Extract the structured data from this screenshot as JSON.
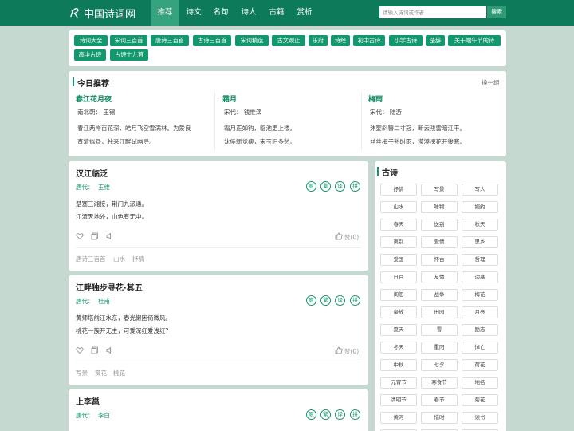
{
  "header": {
    "logo_text": "中国诗词网",
    "nav": [
      "推荐",
      "诗文",
      "名句",
      "诗人",
      "古籍",
      "赏析"
    ],
    "search_placeholder": "请输入诗词或作者",
    "search_button": "搜索"
  },
  "tags": [
    "诗词大全",
    "宋词三百首",
    "唐诗三百首",
    "古诗三百首",
    "宋词精选",
    "古文观止",
    "乐府",
    "诗经",
    "初中古诗",
    "小学古诗",
    "楚辞",
    "关于端午节的诗",
    "高中古诗",
    "古诗十九首"
  ],
  "recommend": {
    "title": "今日推荐",
    "refresh": "换一组",
    "items": [
      {
        "title": "春江花月夜",
        "meta": "南北朝： 王锡",
        "lines": [
          "春江两岸百花深，皓月飞空雪满林。为爱良",
          "宵清似昼，独来江畔试幽寻。"
        ]
      },
      {
        "title": "霜月",
        "meta": "宋代： 钱惟演",
        "lines": [
          "霜月正如钩，临池更上楼。",
          "沈侯新觉瘦，宋玉旧多愁。"
        ]
      },
      {
        "title": "梅雨",
        "meta": "宋代： 陆游",
        "lines": [
          "沐婴斜簪二寸冠，断云残雷暗江干。",
          "丝丝梅子熟时雨，漠漠楝花开後寒。"
        ]
      }
    ]
  },
  "poem_buttons": [
    "原",
    "繁",
    "译",
    "拼"
  ],
  "poems": [
    {
      "title": "汉江临泛",
      "dynasty": "唐代：",
      "author": "王维",
      "lines": [
        "楚塞三湘接，荆门九派通。",
        "江流天地外，山色有无中。"
      ],
      "like": "赞(0)",
      "tags": [
        "唐诗三百首",
        "山水",
        "抒情"
      ]
    },
    {
      "title": "江畔独步寻花·其五",
      "dynasty": "唐代：",
      "author": "杜甫",
      "lines": [
        "黄师塔前江水东，春光懒困倚微风。",
        "桃花一簇开无主，可爱深红爱浅红？"
      ],
      "like": "赞(0)",
      "tags": [
        "写景",
        "赏花",
        "桃花"
      ]
    },
    {
      "title": "上李邕",
      "dynasty": "唐代：",
      "author": "李白",
      "lines": [],
      "like": "",
      "tags": []
    }
  ],
  "sidebar": {
    "title": "古诗",
    "tags": [
      "抒情",
      "写景",
      "写人",
      "山水",
      "咏物",
      "婉约",
      "春天",
      "送别",
      "秋天",
      "离别",
      "爱情",
      "思乡",
      "爱国",
      "怀古",
      "哲理",
      "日月",
      "友情",
      "边塞",
      "闺怨",
      "战争",
      "梅花",
      "豪放",
      "田园",
      "月亮",
      "夏天",
      "雪",
      "励志",
      "冬天",
      "重阳",
      "悼亡",
      "中秋",
      "七夕",
      "荷花",
      "元宵节",
      "寒食节",
      "地名",
      "清明节",
      "春节",
      "菊花",
      "黄河",
      "惜时",
      "读书",
      "儿童",
      "民谣",
      "忧民"
    ]
  },
  "colors": {
    "header": "#0d7a5a",
    "accent": "#12986e",
    "background": "#c5d9d1"
  }
}
